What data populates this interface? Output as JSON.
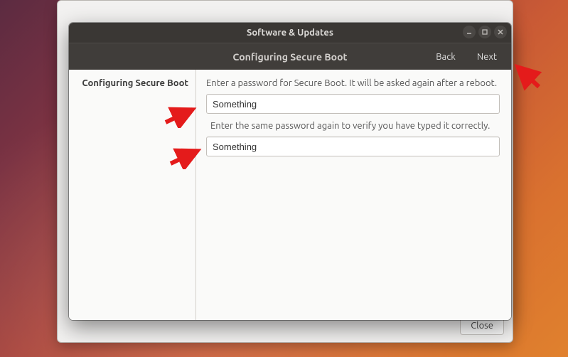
{
  "window": {
    "title": "Software & Updates"
  },
  "header": {
    "title": "Configuring Secure Boot",
    "back_label": "Back",
    "next_label": "Next"
  },
  "sidebar": {
    "heading": "Configuring Secure Boot"
  },
  "form": {
    "instruction_1": "Enter a password for Secure Boot. It will be asked again after a reboot.",
    "password_value": "Something",
    "instruction_2": "Enter the same password again to verify you have typed it correctly.",
    "confirm_value": "Something"
  },
  "back_window": {
    "close_label": "Close"
  }
}
